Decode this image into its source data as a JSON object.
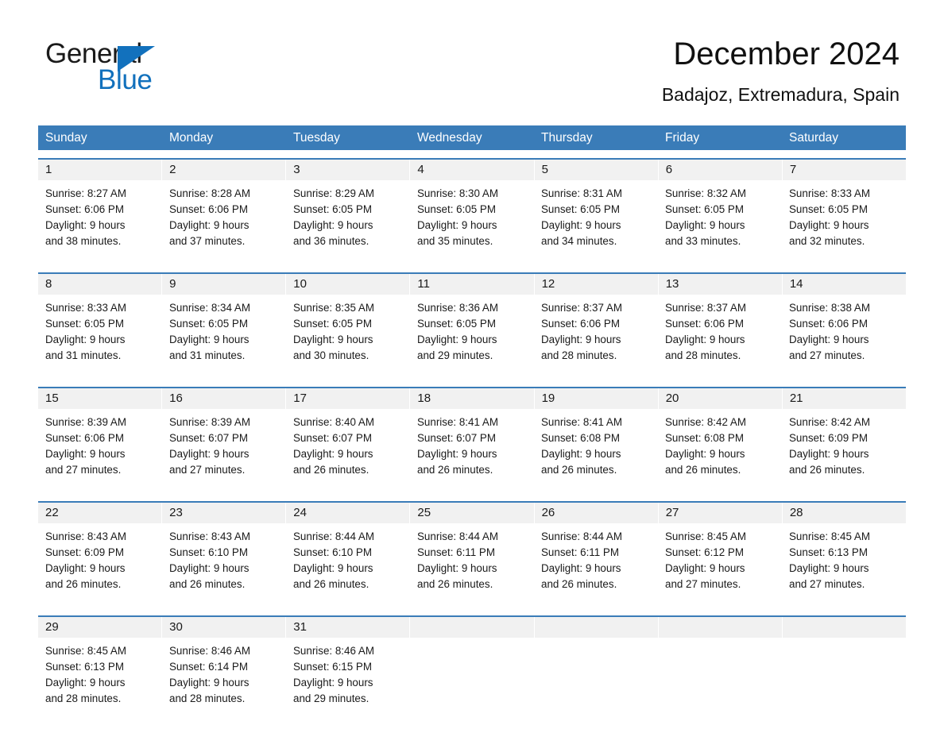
{
  "brand": {
    "word_one": "General",
    "word_two": "Blue",
    "triangle_color": "#1271bd",
    "text_color": "#1a1a1a"
  },
  "header": {
    "title": "December 2024",
    "subtitle": "Badajoz, Extremadura, Spain"
  },
  "theme": {
    "header_blue": "#3a7cb8",
    "row_divider_blue": "#3a7cb8",
    "daynum_band": "#f1f1f1",
    "text": "#1a1a1a"
  },
  "weekday_headers": [
    "Sunday",
    "Monday",
    "Tuesday",
    "Wednesday",
    "Thursday",
    "Friday",
    "Saturday"
  ],
  "weeks": [
    {
      "days": [
        {
          "num": "1",
          "sunrise": "Sunrise: 8:27 AM",
          "sunset": "Sunset: 6:06 PM",
          "daylight_1": "Daylight: 9 hours",
          "daylight_2": "and 38 minutes."
        },
        {
          "num": "2",
          "sunrise": "Sunrise: 8:28 AM",
          "sunset": "Sunset: 6:06 PM",
          "daylight_1": "Daylight: 9 hours",
          "daylight_2": "and 37 minutes."
        },
        {
          "num": "3",
          "sunrise": "Sunrise: 8:29 AM",
          "sunset": "Sunset: 6:05 PM",
          "daylight_1": "Daylight: 9 hours",
          "daylight_2": "and 36 minutes."
        },
        {
          "num": "4",
          "sunrise": "Sunrise: 8:30 AM",
          "sunset": "Sunset: 6:05 PM",
          "daylight_1": "Daylight: 9 hours",
          "daylight_2": "and 35 minutes."
        },
        {
          "num": "5",
          "sunrise": "Sunrise: 8:31 AM",
          "sunset": "Sunset: 6:05 PM",
          "daylight_1": "Daylight: 9 hours",
          "daylight_2": "and 34 minutes."
        },
        {
          "num": "6",
          "sunrise": "Sunrise: 8:32 AM",
          "sunset": "Sunset: 6:05 PM",
          "daylight_1": "Daylight: 9 hours",
          "daylight_2": "and 33 minutes."
        },
        {
          "num": "7",
          "sunrise": "Sunrise: 8:33 AM",
          "sunset": "Sunset: 6:05 PM",
          "daylight_1": "Daylight: 9 hours",
          "daylight_2": "and 32 minutes."
        }
      ]
    },
    {
      "days": [
        {
          "num": "8",
          "sunrise": "Sunrise: 8:33 AM",
          "sunset": "Sunset: 6:05 PM",
          "daylight_1": "Daylight: 9 hours",
          "daylight_2": "and 31 minutes."
        },
        {
          "num": "9",
          "sunrise": "Sunrise: 8:34 AM",
          "sunset": "Sunset: 6:05 PM",
          "daylight_1": "Daylight: 9 hours",
          "daylight_2": "and 31 minutes."
        },
        {
          "num": "10",
          "sunrise": "Sunrise: 8:35 AM",
          "sunset": "Sunset: 6:05 PM",
          "daylight_1": "Daylight: 9 hours",
          "daylight_2": "and 30 minutes."
        },
        {
          "num": "11",
          "sunrise": "Sunrise: 8:36 AM",
          "sunset": "Sunset: 6:05 PM",
          "daylight_1": "Daylight: 9 hours",
          "daylight_2": "and 29 minutes."
        },
        {
          "num": "12",
          "sunrise": "Sunrise: 8:37 AM",
          "sunset": "Sunset: 6:06 PM",
          "daylight_1": "Daylight: 9 hours",
          "daylight_2": "and 28 minutes."
        },
        {
          "num": "13",
          "sunrise": "Sunrise: 8:37 AM",
          "sunset": "Sunset: 6:06 PM",
          "daylight_1": "Daylight: 9 hours",
          "daylight_2": "and 28 minutes."
        },
        {
          "num": "14",
          "sunrise": "Sunrise: 8:38 AM",
          "sunset": "Sunset: 6:06 PM",
          "daylight_1": "Daylight: 9 hours",
          "daylight_2": "and 27 minutes."
        }
      ]
    },
    {
      "days": [
        {
          "num": "15",
          "sunrise": "Sunrise: 8:39 AM",
          "sunset": "Sunset: 6:06 PM",
          "daylight_1": "Daylight: 9 hours",
          "daylight_2": "and 27 minutes."
        },
        {
          "num": "16",
          "sunrise": "Sunrise: 8:39 AM",
          "sunset": "Sunset: 6:07 PM",
          "daylight_1": "Daylight: 9 hours",
          "daylight_2": "and 27 minutes."
        },
        {
          "num": "17",
          "sunrise": "Sunrise: 8:40 AM",
          "sunset": "Sunset: 6:07 PM",
          "daylight_1": "Daylight: 9 hours",
          "daylight_2": "and 26 minutes."
        },
        {
          "num": "18",
          "sunrise": "Sunrise: 8:41 AM",
          "sunset": "Sunset: 6:07 PM",
          "daylight_1": "Daylight: 9 hours",
          "daylight_2": "and 26 minutes."
        },
        {
          "num": "19",
          "sunrise": "Sunrise: 8:41 AM",
          "sunset": "Sunset: 6:08 PM",
          "daylight_1": "Daylight: 9 hours",
          "daylight_2": "and 26 minutes."
        },
        {
          "num": "20",
          "sunrise": "Sunrise: 8:42 AM",
          "sunset": "Sunset: 6:08 PM",
          "daylight_1": "Daylight: 9 hours",
          "daylight_2": "and 26 minutes."
        },
        {
          "num": "21",
          "sunrise": "Sunrise: 8:42 AM",
          "sunset": "Sunset: 6:09 PM",
          "daylight_1": "Daylight: 9 hours",
          "daylight_2": "and 26 minutes."
        }
      ]
    },
    {
      "days": [
        {
          "num": "22",
          "sunrise": "Sunrise: 8:43 AM",
          "sunset": "Sunset: 6:09 PM",
          "daylight_1": "Daylight: 9 hours",
          "daylight_2": "and 26 minutes."
        },
        {
          "num": "23",
          "sunrise": "Sunrise: 8:43 AM",
          "sunset": "Sunset: 6:10 PM",
          "daylight_1": "Daylight: 9 hours",
          "daylight_2": "and 26 minutes."
        },
        {
          "num": "24",
          "sunrise": "Sunrise: 8:44 AM",
          "sunset": "Sunset: 6:10 PM",
          "daylight_1": "Daylight: 9 hours",
          "daylight_2": "and 26 minutes."
        },
        {
          "num": "25",
          "sunrise": "Sunrise: 8:44 AM",
          "sunset": "Sunset: 6:11 PM",
          "daylight_1": "Daylight: 9 hours",
          "daylight_2": "and 26 minutes."
        },
        {
          "num": "26",
          "sunrise": "Sunrise: 8:44 AM",
          "sunset": "Sunset: 6:11 PM",
          "daylight_1": "Daylight: 9 hours",
          "daylight_2": "and 26 minutes."
        },
        {
          "num": "27",
          "sunrise": "Sunrise: 8:45 AM",
          "sunset": "Sunset: 6:12 PM",
          "daylight_1": "Daylight: 9 hours",
          "daylight_2": "and 27 minutes."
        },
        {
          "num": "28",
          "sunrise": "Sunrise: 8:45 AM",
          "sunset": "Sunset: 6:13 PM",
          "daylight_1": "Daylight: 9 hours",
          "daylight_2": "and 27 minutes."
        }
      ]
    },
    {
      "days": [
        {
          "num": "29",
          "sunrise": "Sunrise: 8:45 AM",
          "sunset": "Sunset: 6:13 PM",
          "daylight_1": "Daylight: 9 hours",
          "daylight_2": "and 28 minutes."
        },
        {
          "num": "30",
          "sunrise": "Sunrise: 8:46 AM",
          "sunset": "Sunset: 6:14 PM",
          "daylight_1": "Daylight: 9 hours",
          "daylight_2": "and 28 minutes."
        },
        {
          "num": "31",
          "sunrise": "Sunrise: 8:46 AM",
          "sunset": "Sunset: 6:15 PM",
          "daylight_1": "Daylight: 9 hours",
          "daylight_2": "and 29 minutes."
        },
        {
          "num": "",
          "sunrise": "",
          "sunset": "",
          "daylight_1": "",
          "daylight_2": ""
        },
        {
          "num": "",
          "sunrise": "",
          "sunset": "",
          "daylight_1": "",
          "daylight_2": ""
        },
        {
          "num": "",
          "sunrise": "",
          "sunset": "",
          "daylight_1": "",
          "daylight_2": ""
        },
        {
          "num": "",
          "sunrise": "",
          "sunset": "",
          "daylight_1": "",
          "daylight_2": ""
        }
      ]
    }
  ]
}
